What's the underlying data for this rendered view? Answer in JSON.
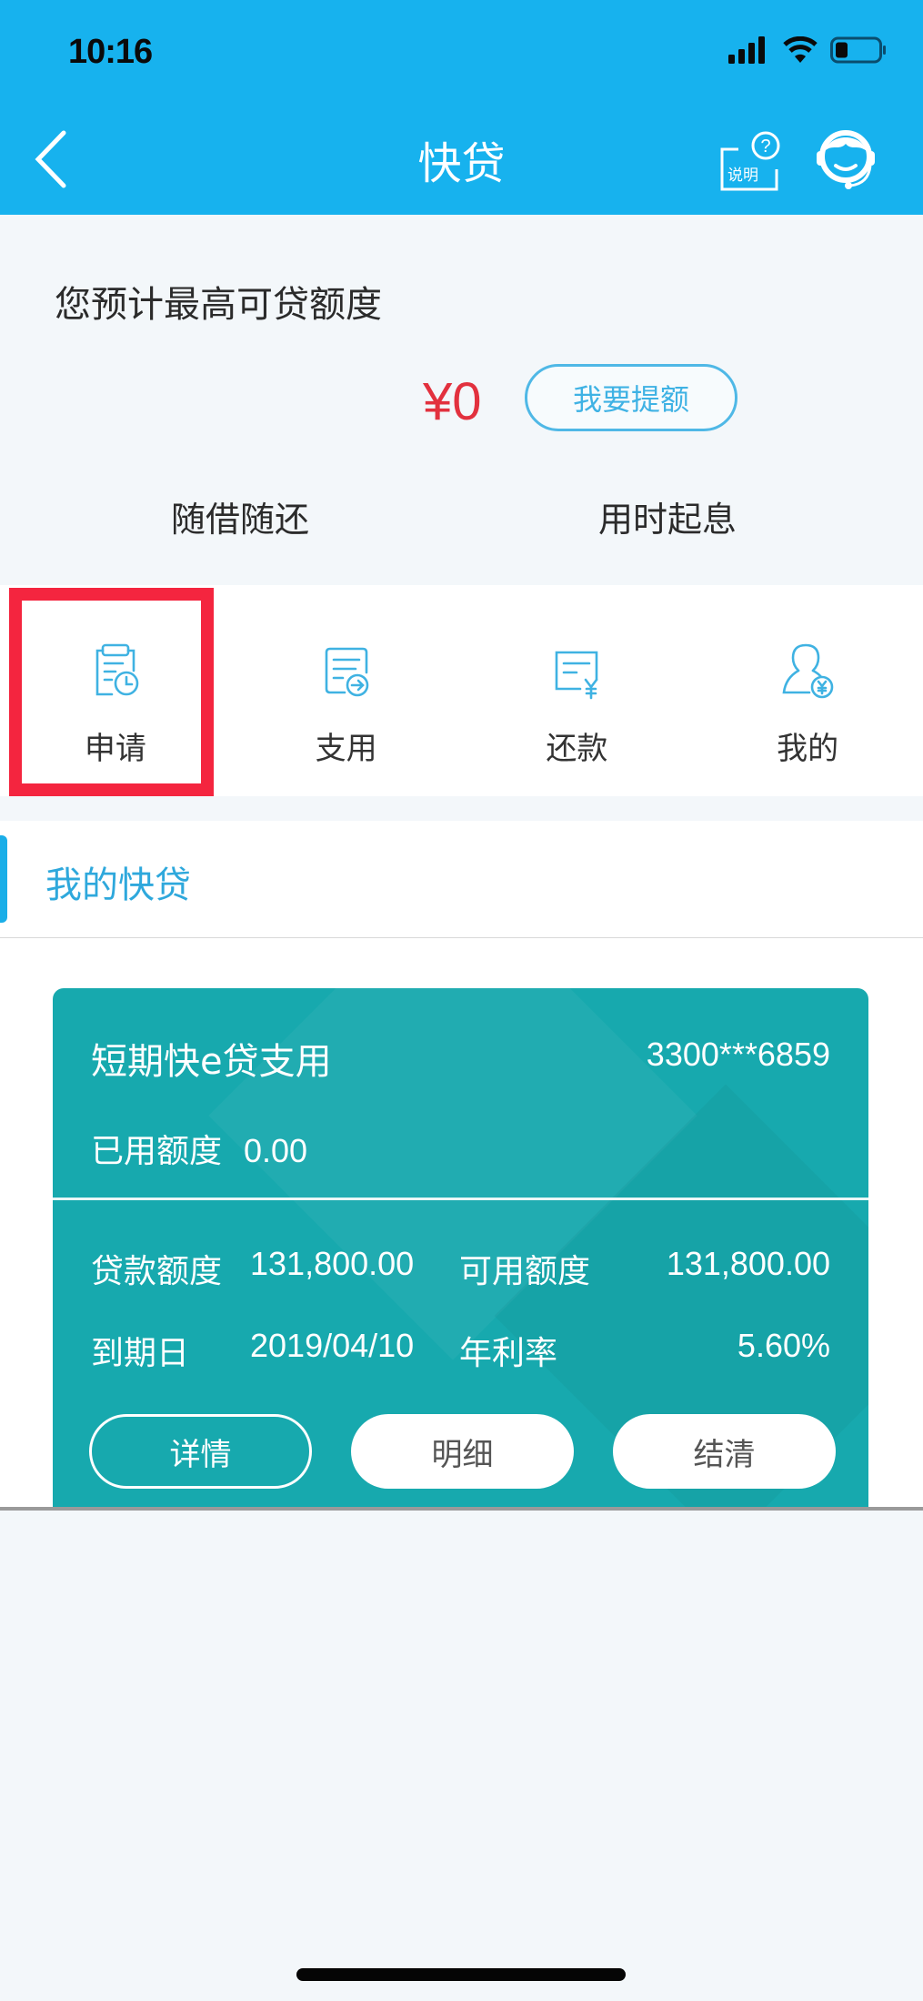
{
  "status_bar": {
    "time": "10:16",
    "icons": [
      "signal-icon",
      "wifi-icon",
      "battery-icon"
    ]
  },
  "header": {
    "title": "快贷",
    "back_icon": "chevron-left-icon",
    "help_label": "说明",
    "help_icon": "question-circle-icon",
    "service_icon": "customer-service-icon",
    "color": "#17b2ee"
  },
  "summary": {
    "limit_label": "您预计最高可贷额度",
    "amount": "¥0",
    "raise_button": "我要提额",
    "features": [
      "随借随还",
      "用时起息"
    ]
  },
  "actions": [
    {
      "label": "申请",
      "icon": "clipboard-clock-icon",
      "highlighted": true
    },
    {
      "label": "支用",
      "icon": "document-arrow-icon",
      "highlighted": false
    },
    {
      "label": "还款",
      "icon": "bill-yen-icon",
      "highlighted": false
    },
    {
      "label": "我的",
      "icon": "user-yen-icon",
      "highlighted": false
    }
  ],
  "section": {
    "title": "我的快贷"
  },
  "loan_card": {
    "product": "短期快e贷支用",
    "account": "3300***6859",
    "used_label": "已用额度",
    "used_value": "0.00",
    "loan_limit_label": "贷款额度",
    "loan_limit_value": "131,800.00",
    "available_label": "可用额度",
    "available_value": "131,800.00",
    "due_label": "到期日",
    "due_value": "2019/04/10",
    "rate_label": "年利率",
    "rate_value": "5.60%",
    "buttons": [
      "详情",
      "明细",
      "结清"
    ],
    "color": "#17a9ae"
  },
  "highlight_color": "#f4253f"
}
